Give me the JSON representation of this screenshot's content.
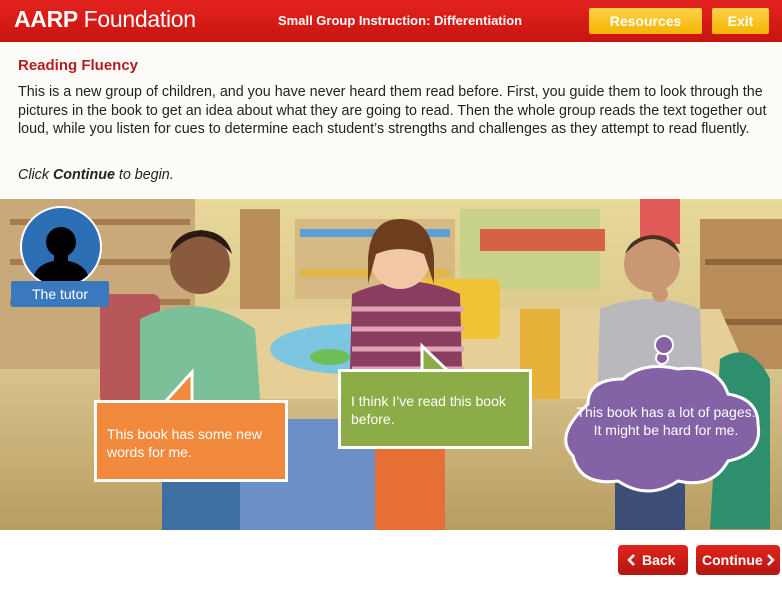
{
  "header": {
    "logo_brand": "AARP",
    "logo_sub": "Foundation",
    "course_title": "Small Group Instruction: Differentiation",
    "resources_label": "Resources",
    "exit_label": "Exit"
  },
  "content": {
    "section_title": "Reading Fluency",
    "body": "This is a new group of children, and you have never heard them read before. First, you guide them to look through the pictures in the book to get an idea about what they are going to read. Then the whole group reads the text together out loud, while you listen for cues to determine each student’s strengths and challenges as they attempt to read fluently.",
    "instruction_pre": "Click ",
    "instruction_bold": "Continue",
    "instruction_post": " to begin."
  },
  "scene": {
    "tutor_label": "The tutor",
    "bubbles": {
      "left": "This book has some new words for me.",
      "center": "I think I’ve read this book before.",
      "right": "This book has a lot of pages. It might be hard for me."
    }
  },
  "footer": {
    "back_label": "Back",
    "continue_label": "Continue"
  },
  "colors": {
    "header_red": "#d81d19",
    "button_yellow": "#f5b400",
    "title_red": "#b01f24",
    "tutor_blue": "#3a79be",
    "bubble_orange": "#f28a3e",
    "bubble_green": "#8bac47",
    "bubble_purple": "#8462a6"
  }
}
